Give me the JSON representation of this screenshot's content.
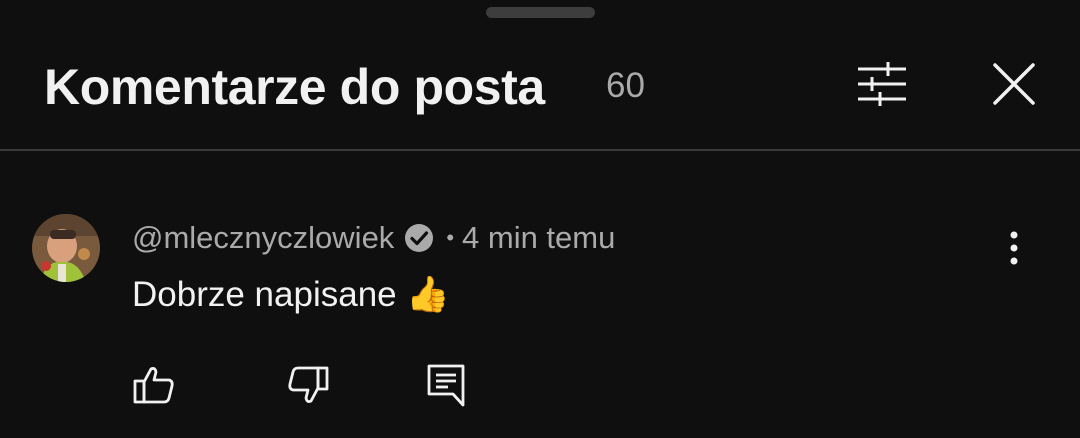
{
  "header": {
    "title": "Komentarze do posta",
    "count": "60",
    "filter_icon": "sliders-icon",
    "close_icon": "close-icon"
  },
  "comment": {
    "author": "@mlecznyczlowiek",
    "verified_icon": "verified-check-icon",
    "separator": "•",
    "time": "4 min temu",
    "text": "Dobrze napisane 👍",
    "more_icon": "more-vertical-icon",
    "actions": [
      "like-icon",
      "dislike-icon",
      "reply-icon"
    ]
  },
  "colors": {
    "background": "#0f0f0f",
    "primary_text": "#f1f1f1",
    "secondary_text": "#aaaaaa",
    "divider": "#3a3a3a"
  }
}
